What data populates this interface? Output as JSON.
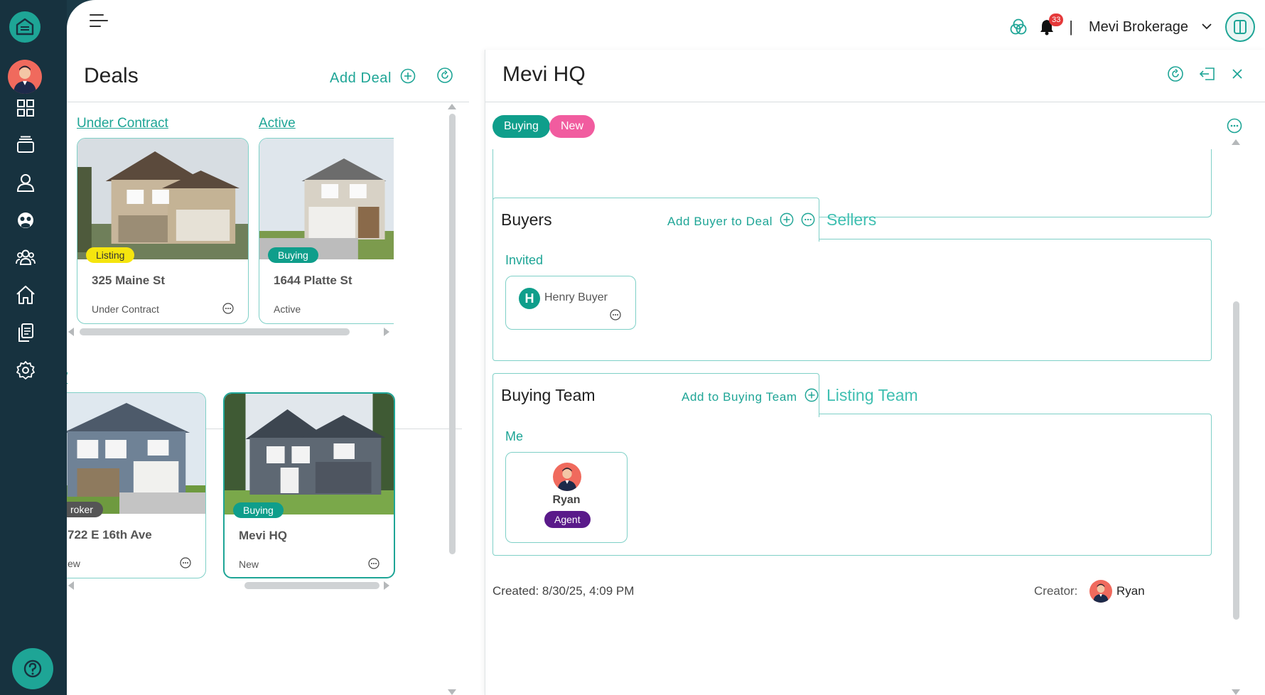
{
  "app": {
    "icons": [
      "home-logo-icon",
      "dashboard-icon",
      "inbox-icon",
      "person-icon",
      "support-icon",
      "contacts-icon",
      "properties-icon",
      "documents-icon",
      "settings-icon",
      "help-icon"
    ]
  },
  "topbar": {
    "notification_count": "33",
    "separator": "|",
    "brokerage_name": "Mevi Brokerage"
  },
  "deals": {
    "title": "Deals",
    "add_label": "Add Deal",
    "columns": [
      {
        "label": "Under Contract",
        "cards": [
          {
            "tag": "Listing",
            "address": "325 Maine St",
            "status": "Under Contract"
          }
        ]
      },
      {
        "label": "Active",
        "cards": [
          {
            "tag": "Buying",
            "address": "1644 Platte St",
            "status": "Active"
          }
        ]
      }
    ],
    "row2": {
      "label": "/",
      "cards": [
        {
          "tag": "roker",
          "address": "722 E 16th Ave",
          "status": "ew"
        },
        {
          "tag": "Buying",
          "address": "Mevi HQ",
          "status": "New"
        }
      ]
    }
  },
  "detail": {
    "title": "Mevi HQ",
    "pills": {
      "type": "Buying",
      "stage": "New"
    },
    "buyers": {
      "tab": "Buyers",
      "add_label": "Add Buyer to Deal",
      "other_tab": "Sellers",
      "group_label": "Invited",
      "person": {
        "initial": "H",
        "name": "Henry Buyer"
      }
    },
    "team": {
      "tab": "Buying Team",
      "add_label": "Add to Buying Team",
      "other_tab": "Listing Team",
      "group_label": "Me",
      "person": {
        "name": "Ryan",
        "role": "Agent"
      }
    },
    "created": "Created: 8/30/25, 4:09 PM",
    "creator_label": "Creator:",
    "creator_name": "Ryan"
  },
  "colors": {
    "accent": "#1ea596",
    "rail": "#17323f",
    "listing_tag": "#f5e50e",
    "buying_tag": "#0f9e8b",
    "new_pill": "#f15c9f",
    "agent_badge": "#5a1a8a"
  }
}
